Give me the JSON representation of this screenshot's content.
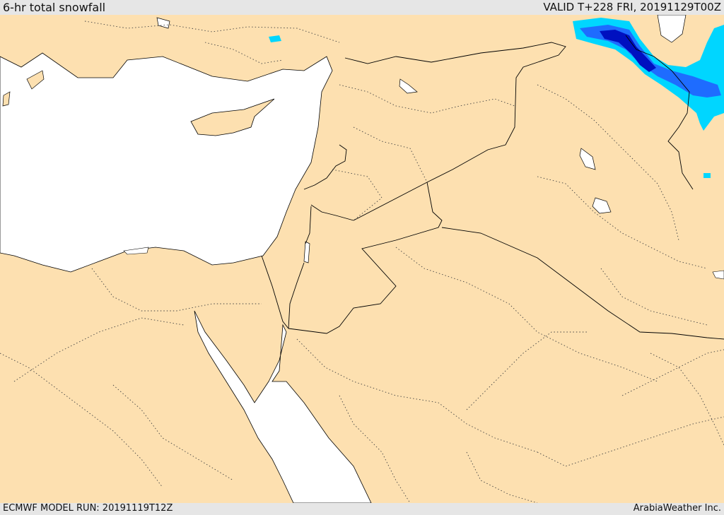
{
  "header": {
    "title": "6-hr total snowfall",
    "valid": "VALID T+228 FRI, 20191129T00Z"
  },
  "footer": {
    "model_run": "ECMWF MODEL RUN: 20191119T12Z",
    "credit": "ArabiaWeather Inc."
  },
  "colors": {
    "land": "#fde0b0",
    "water": "#ffffff",
    "snow_light": "#00d6ff",
    "snow_medium": "#1e6cff",
    "snow_heavy": "#0010c0"
  }
}
